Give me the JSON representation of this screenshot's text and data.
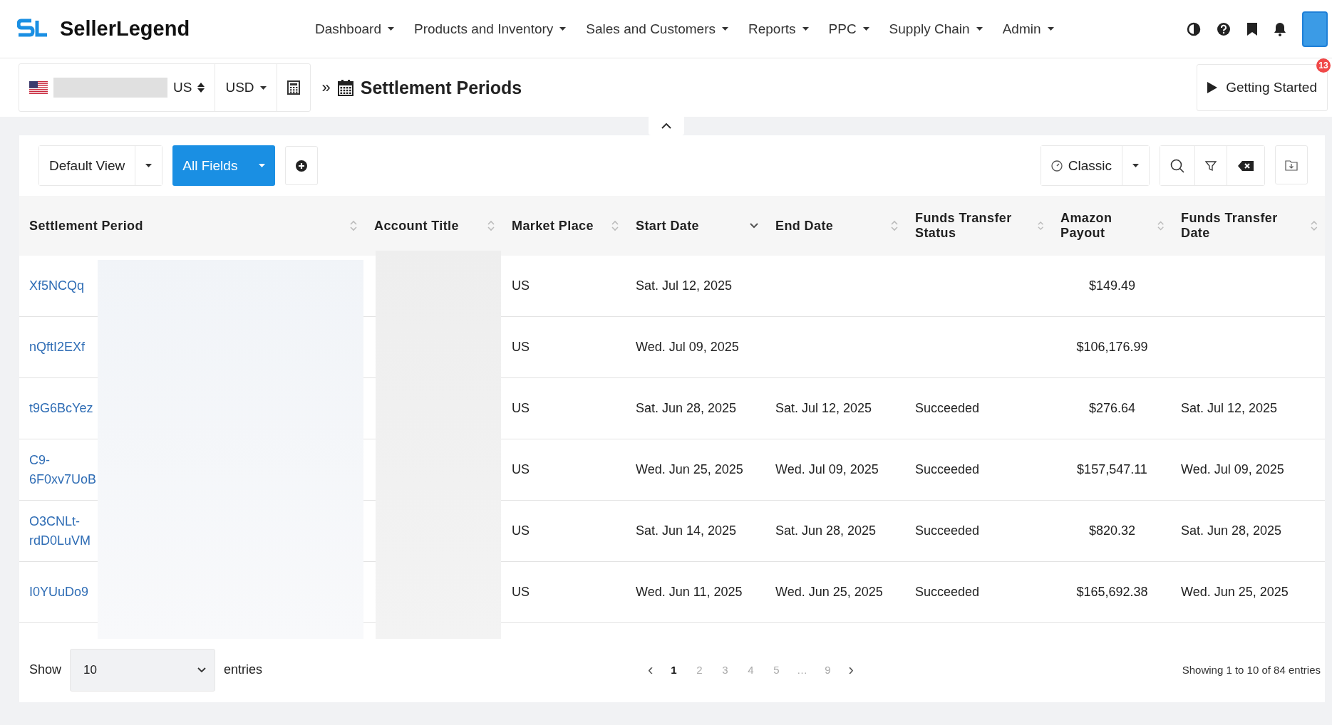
{
  "brand": {
    "name": "SellerLegend"
  },
  "nav": [
    {
      "label": "Dashboard"
    },
    {
      "label": "Products and Inventory"
    },
    {
      "label": "Sales and Customers"
    },
    {
      "label": "Reports"
    },
    {
      "label": "PPC"
    },
    {
      "label": "Supply Chain"
    },
    {
      "label": "Admin"
    }
  ],
  "account_bar": {
    "marketplace": "US",
    "currency": "USD",
    "breadcrumb_sep": "»",
    "title": "Settlement Periods",
    "getting_started": "Getting Started",
    "badge": "13"
  },
  "toolbar": {
    "view": "Default View",
    "fields": "All Fields",
    "mode": "Classic"
  },
  "table": {
    "columns": [
      {
        "label": "Settlement Period",
        "sorted": false
      },
      {
        "label": "Account Title",
        "sorted": false
      },
      {
        "label": "Market Place",
        "sorted": false
      },
      {
        "label": "Start Date",
        "sorted": true
      },
      {
        "label": "End Date",
        "sorted": false
      },
      {
        "label": "Funds Transfer Status",
        "sorted": false
      },
      {
        "label": "Amazon Payout",
        "sorted": false
      },
      {
        "label": "Funds Transfer Date",
        "sorted": false
      }
    ],
    "rows": [
      {
        "period": "Xf5NCQq",
        "market": "US",
        "start": "Sat. Jul 12, 2025",
        "end": "",
        "status": "",
        "payout": "$149.49",
        "transfer_date": ""
      },
      {
        "period": "nQftI2EXf",
        "market": "US",
        "start": "Wed. Jul 09, 2025",
        "end": "",
        "status": "",
        "payout": "$106,176.99",
        "transfer_date": ""
      },
      {
        "period": "t9G6BcYez",
        "market": "US",
        "start": "Sat. Jun 28, 2025",
        "end": "Sat. Jul 12, 2025",
        "status": "Succeeded",
        "payout": "$276.64",
        "transfer_date": "Sat. Jul 12, 2025"
      },
      {
        "period": "C9-6F0xv7UoB",
        "market": "US",
        "start": "Wed. Jun 25, 2025",
        "end": "Wed. Jul 09, 2025",
        "status": "Succeeded",
        "payout": "$157,547.11",
        "transfer_date": "Wed. Jul 09, 2025"
      },
      {
        "period": "O3CNLt-rdD0LuVM",
        "market": "US",
        "start": "Sat. Jun 14, 2025",
        "end": "Sat. Jun 28, 2025",
        "status": "Succeeded",
        "payout": "$820.32",
        "transfer_date": "Sat. Jun 28, 2025"
      },
      {
        "period": "I0YUuDo9",
        "market": "US",
        "start": "Wed. Jun 11, 2025",
        "end": "Wed. Jun 25, 2025",
        "status": "Succeeded",
        "payout": "$165,692.38",
        "transfer_date": "Wed. Jun 25, 2025"
      }
    ]
  },
  "footer": {
    "show": "Show",
    "page_size": "10",
    "entries": "entries",
    "prev": "‹",
    "next": "›",
    "pages": [
      {
        "label": "1",
        "selected": true
      },
      {
        "label": "2",
        "selected": false
      },
      {
        "label": "3",
        "selected": false
      },
      {
        "label": "4",
        "selected": false
      },
      {
        "label": "5",
        "selected": false
      },
      {
        "label": "…",
        "selected": false
      },
      {
        "label": "9",
        "selected": false
      }
    ],
    "summary": "Showing 1 to 10 of 84 entries"
  }
}
